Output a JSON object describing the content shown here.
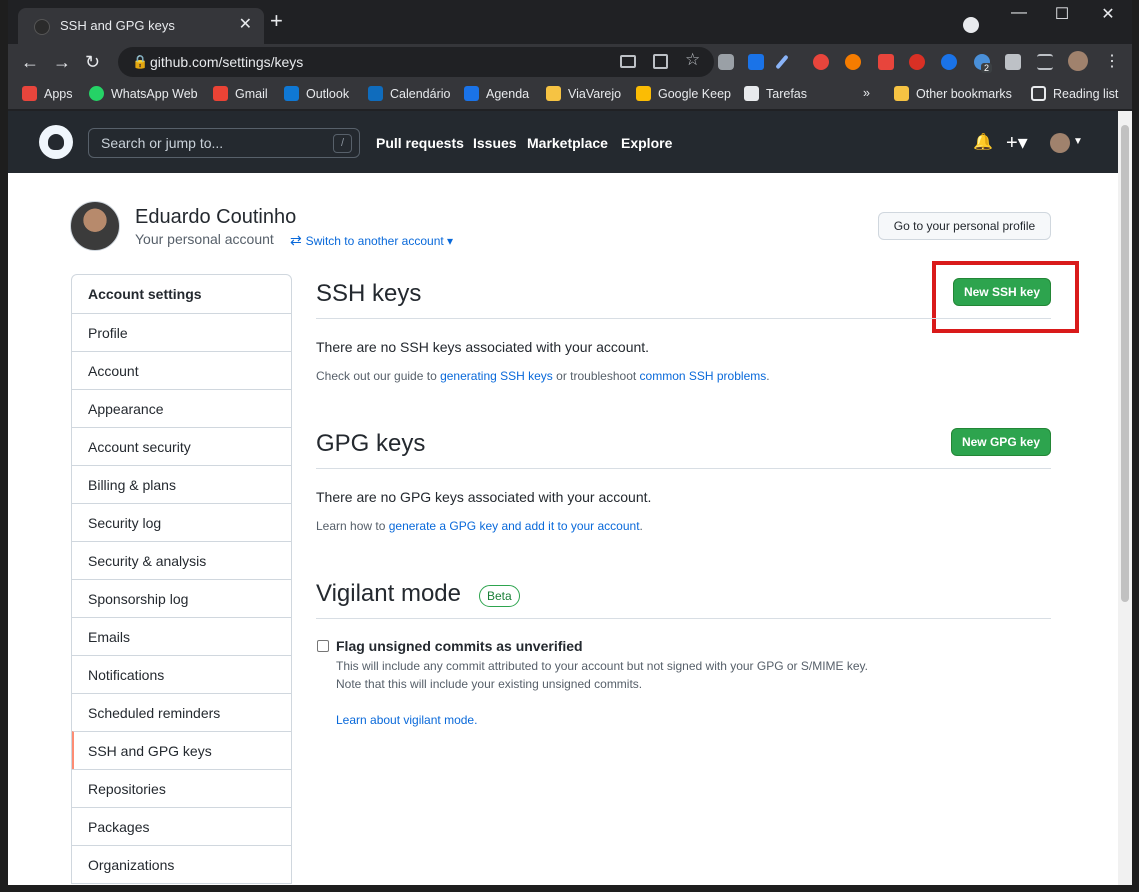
{
  "browser": {
    "tab_title": "SSH and GPG keys",
    "url": "github.com/settings/keys",
    "bookmarks": [
      {
        "label": "Apps",
        "color": "#e8453c"
      },
      {
        "label": "WhatsApp Web",
        "color": "#25d366"
      },
      {
        "label": "Gmail",
        "color": "#ea4335"
      },
      {
        "label": "Outlook",
        "color": "#0f78d4"
      },
      {
        "label": "Calendário",
        "color": "#0f6cbd"
      },
      {
        "label": "Agenda",
        "color": "#1a73e8"
      },
      {
        "label": "ViaVarejo",
        "color": "#f6c343"
      },
      {
        "label": "Google Keep",
        "color": "#fbbc04"
      },
      {
        "label": "Tarefas",
        "color": "#e8eaed"
      }
    ],
    "more_bookmarks": "»",
    "other_bookmarks": "Other bookmarks",
    "reading_list": "Reading list",
    "extension_badge": "2"
  },
  "github": {
    "search_placeholder": "Search or jump to...",
    "search_key": "/",
    "nav": [
      "Pull requests",
      "Issues",
      "Marketplace",
      "Explore"
    ]
  },
  "profile": {
    "name": "Eduardo Coutinho",
    "subtitle": "Your personal account",
    "switch_label": "Switch to another account",
    "profile_button": "Go to your personal profile"
  },
  "sidebar": {
    "items": [
      "Account settings",
      "Profile",
      "Account",
      "Appearance",
      "Account security",
      "Billing & plans",
      "Security log",
      "Security & analysis",
      "Sponsorship log",
      "Emails",
      "Notifications",
      "Scheduled reminders",
      "SSH and GPG keys",
      "Repositories",
      "Packages",
      "Organizations"
    ],
    "selected": "SSH and GPG keys"
  },
  "ssh": {
    "title": "SSH keys",
    "button": "New SSH key",
    "empty": "There are no SSH keys associated with your account.",
    "guide_pre": "Check out our guide to ",
    "guide_link1": "generating SSH keys",
    "guide_mid": " or troubleshoot ",
    "guide_link2": "common SSH problems",
    "guide_post": "."
  },
  "gpg": {
    "title": "GPG keys",
    "button": "New GPG key",
    "empty": "There are no GPG keys associated with your account.",
    "learn_pre": "Learn how to ",
    "learn_link": "generate a GPG key and add it to your account",
    "learn_post": "."
  },
  "vigilant": {
    "title": "Vigilant mode",
    "badge": "Beta",
    "checkbox_label": "Flag unsigned commits as unverified",
    "desc1": "This will include any commit attributed to your account but not signed with your GPG or S/MIME key.",
    "desc2": "Note that this will include your existing unsigned commits.",
    "learn_link": "Learn about vigilant mode."
  },
  "colors": {
    "accent_green": "#2da44e",
    "highlight_red": "#d91a1a",
    "link_blue": "#0969da"
  }
}
